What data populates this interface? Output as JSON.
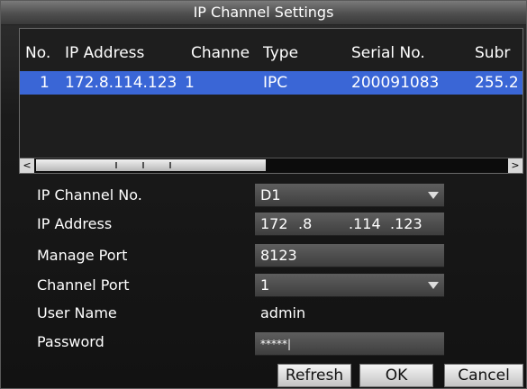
{
  "title": "IP Channel Settings",
  "table": {
    "headers": [
      "No.",
      "IP Address",
      "Channe",
      "Type",
      "Serial No.",
      "Subr"
    ],
    "rows": [
      [
        "1",
        "172.8.114.123",
        "1",
        "IPC",
        "200091083",
        "255.2"
      ]
    ]
  },
  "form": {
    "ip_channel_label": "IP Channel No.",
    "ip_channel_value": "D1",
    "ip_address_label": "IP Address",
    "ip_octets": [
      "172",
      ".8",
      ".114",
      ".123"
    ],
    "manage_port_label": "Manage Port",
    "manage_port_value": "8123",
    "channel_port_label": "Channel Port",
    "channel_port_value": "1",
    "user_name_label": "User Name",
    "user_name_value": "admin",
    "password_label": "Password",
    "password_value": "*****|"
  },
  "buttons": {
    "refresh": "Refresh",
    "ok": "OK",
    "cancel": "Cancel"
  },
  "scroll": {
    "left_arrow": "<",
    "right_arrow": ">"
  },
  "colors": {
    "selection": "#3a66d6"
  },
  "icons": [
    "chevron-down-icon",
    "scroll-left-icon",
    "scroll-right-icon"
  ]
}
